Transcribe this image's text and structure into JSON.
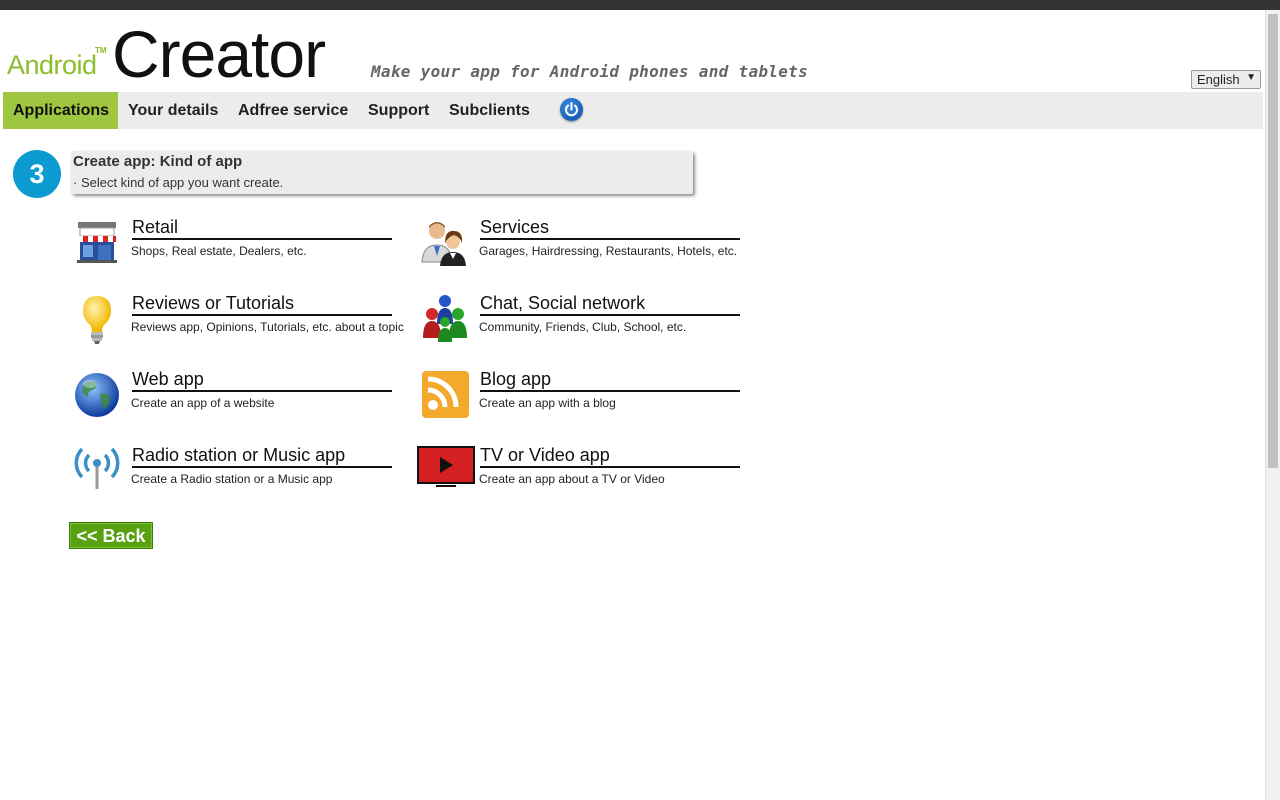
{
  "header": {
    "logo_android": "Android",
    "logo_tm": "TM",
    "logo_creator": "Creator",
    "tagline": "Make your app for Android phones and tablets",
    "language": "English"
  },
  "nav": {
    "items": [
      {
        "label": "Applications",
        "active": true
      },
      {
        "label": "Your details"
      },
      {
        "label": "Adfree service"
      },
      {
        "label": "Support"
      },
      {
        "label": "Subclients"
      }
    ]
  },
  "step": {
    "number": "3",
    "title": "Create app: Kind of app",
    "subtitle": "· Select kind of app you want create."
  },
  "app_types": [
    {
      "title": "Retail",
      "desc": "Shops, Real estate, Dealers, etc.",
      "icon": "store-icon"
    },
    {
      "title": "Services",
      "desc": "Garages, Hairdressing, Restaurants, Hotels, etc.",
      "icon": "people-icon"
    },
    {
      "title": "Reviews or Tutorials",
      "desc": "Reviews app, Opinions, Tutorials, etc. about a topic",
      "icon": "lightbulb-icon"
    },
    {
      "title": "Chat, Social network",
      "desc": "Community, Friends, Club, School, etc.",
      "icon": "community-icon"
    },
    {
      "title": "Web app",
      "desc": "Create an app of a website",
      "icon": "globe-icon"
    },
    {
      "title": "Blog app",
      "desc": "Create an app with a blog",
      "icon": "rss-icon"
    },
    {
      "title": "Radio station or Music app",
      "desc": "Create a Radio station or a Music app",
      "icon": "radio-antenna-icon"
    },
    {
      "title": "TV or Video app",
      "desc": "Create an app about a TV or Video",
      "icon": "tv-play-icon"
    }
  ],
  "back_label": "<< Back",
  "colors": {
    "brand_green": "#8dbd2c",
    "active_nav": "#9ec641",
    "step_blue": "#0b9bd1",
    "back_green": "#5aa112"
  }
}
